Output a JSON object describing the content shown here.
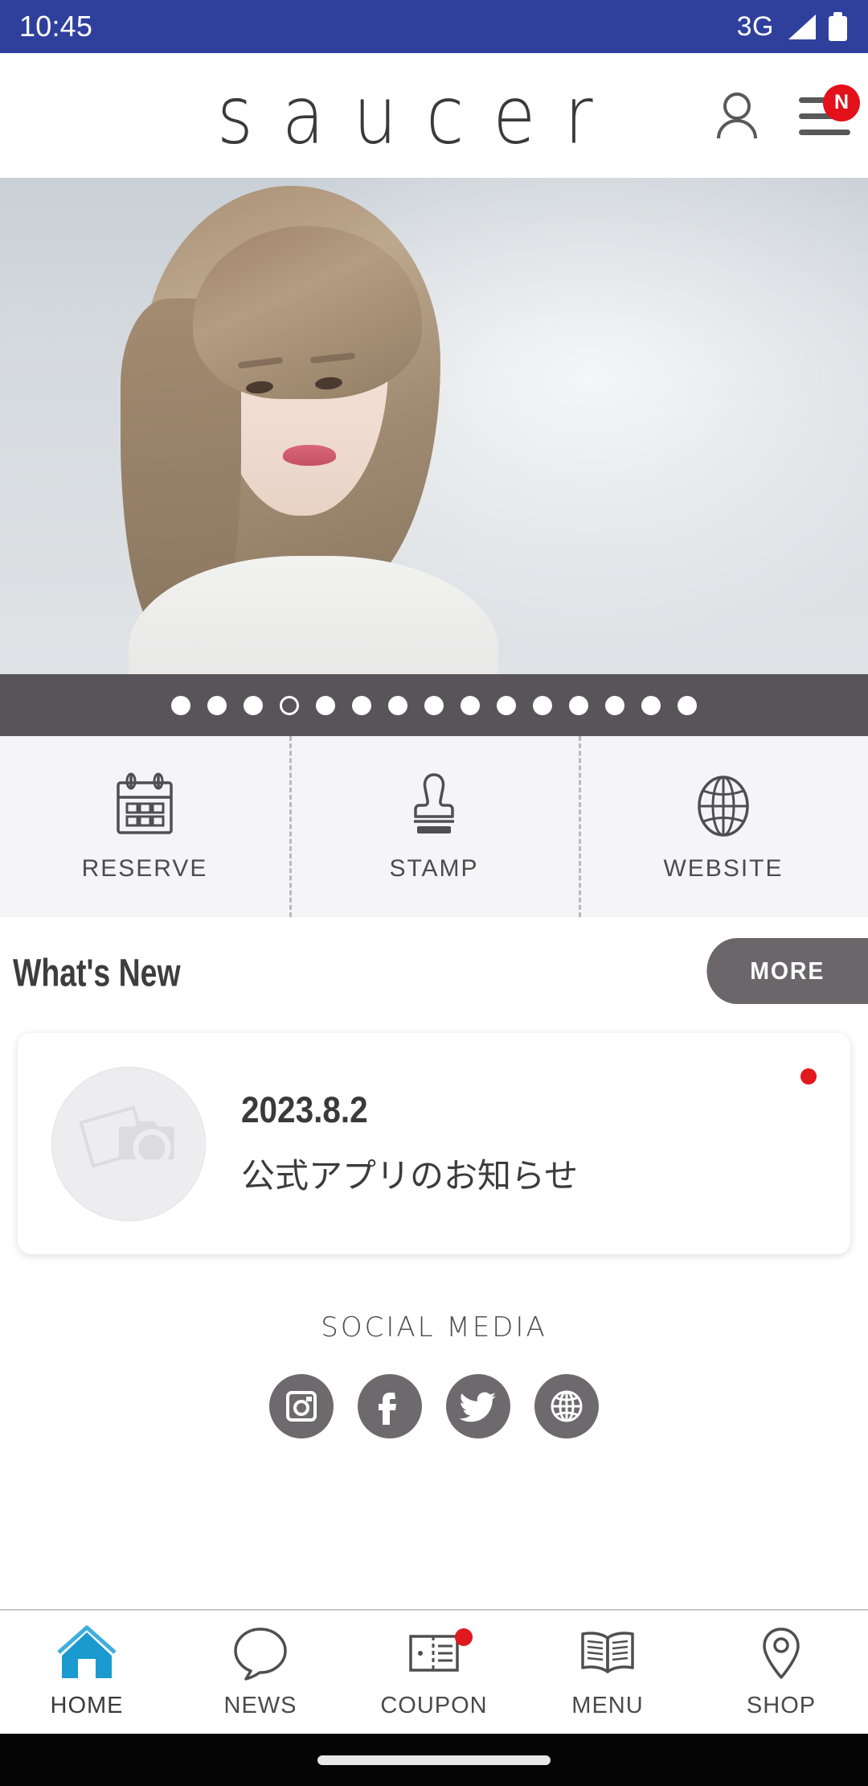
{
  "statusbar": {
    "time": "10:45",
    "network": "3G",
    "signal_icon": "signal-bars-icon",
    "battery_icon": "battery-full-icon",
    "background_color": "#2F409C"
  },
  "header": {
    "logo_text": "saucer",
    "logo_letters": [
      "s",
      "a",
      "u",
      "c",
      "e",
      "r"
    ],
    "account_icon": "person-icon",
    "menu_icon": "hamburger-menu-icon",
    "menu_badge": "N",
    "badge_color": "#E2111A"
  },
  "hero": {
    "alt": "salon-model-photo",
    "slide_count": 15,
    "active_slide": 4
  },
  "carousel": {
    "background_color": "#58545A",
    "dots": 15,
    "active_index": 3
  },
  "quick_actions": [
    {
      "label": "RESERVE",
      "icon": "calendar-icon"
    },
    {
      "label": "STAMP",
      "icon": "stamp-icon"
    },
    {
      "label": "WEBSITE",
      "icon": "globe-icon"
    }
  ],
  "whats_new": {
    "title": "What's New",
    "more_label": "MORE",
    "more_color": "#6B6669"
  },
  "news_items": [
    {
      "date": "2023.8.2",
      "title": "公式アプリのお知らせ",
      "thumbnail_icon": "photo-camera-placeholder-icon",
      "unread": true,
      "unread_color": "#E0191F"
    }
  ],
  "social": {
    "title": "SOCIAL MEDIA",
    "items": [
      {
        "name": "instagram",
        "icon": "instagram-icon"
      },
      {
        "name": "facebook",
        "icon": "facebook-icon"
      },
      {
        "name": "twitter",
        "icon": "twitter-icon"
      },
      {
        "name": "website",
        "icon": "globe-icon"
      }
    ],
    "button_color": "#6D696C"
  },
  "bottom_nav": {
    "active_color": "#1B9AD0",
    "items": [
      {
        "label": "HOME",
        "icon": "home-icon",
        "active": true,
        "badge": false
      },
      {
        "label": "NEWS",
        "icon": "speech-bubble-icon",
        "active": false,
        "badge": false
      },
      {
        "label": "COUPON",
        "icon": "coupon-ticket-icon",
        "active": false,
        "badge": true
      },
      {
        "label": "MENU",
        "icon": "open-book-icon",
        "active": false,
        "badge": false
      },
      {
        "label": "SHOP",
        "icon": "location-pin-icon",
        "active": false,
        "badge": false
      }
    ]
  }
}
